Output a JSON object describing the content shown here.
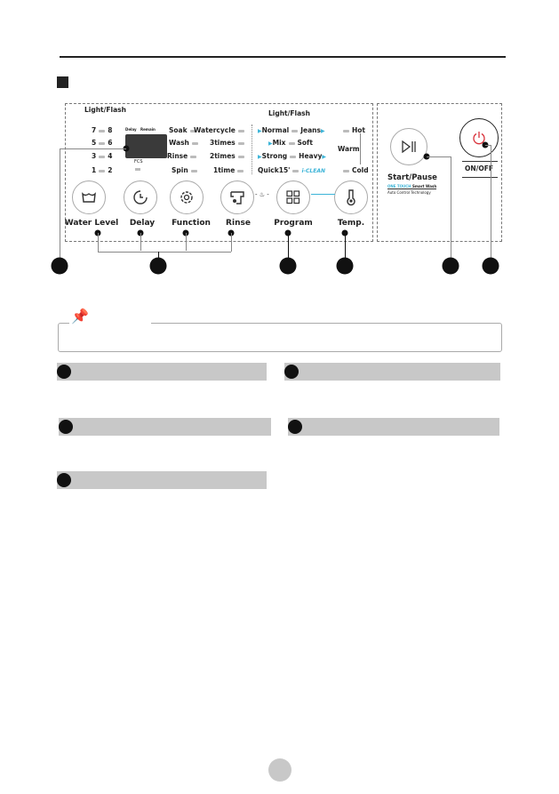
{
  "panel": {
    "light_flash_left": "Light/Flash",
    "light_flash_right": "Light/Flash",
    "water_levels": [
      [
        "7",
        "8"
      ],
      [
        "5",
        "6"
      ],
      [
        "3",
        "4"
      ],
      [
        "1",
        "2"
      ]
    ],
    "display": {
      "delay": "Delay",
      "remain": "Remain",
      "fcs": "FCS"
    },
    "functions": [
      "Soak",
      "Wash",
      "Rinse",
      "Spin"
    ],
    "rinse_counts": [
      "Watercycle",
      "3times",
      "2times",
      "1time"
    ],
    "programs_left": [
      "Normal",
      "Mix",
      "Strong",
      "Quick15'"
    ],
    "programs_right": [
      "Jeans",
      "Soft",
      "Heavy",
      "i-CLEAN"
    ],
    "temps": {
      "hot": "Hot",
      "warm": "Warm",
      "cold": "Cold"
    },
    "buttons": [
      "Water Level",
      "Delay",
      "Function",
      "Rinse",
      "Program",
      "Temp."
    ],
    "start_pause": {
      "label": "Start/Pause",
      "one_touch": "ONE TOUCH",
      "smart_wash": "Smart Wash",
      "tech": "Auto Control Technology"
    },
    "power": {
      "label": "ON/OFF",
      "color": "#d9333c"
    },
    "accent": "#3cb4d8"
  }
}
